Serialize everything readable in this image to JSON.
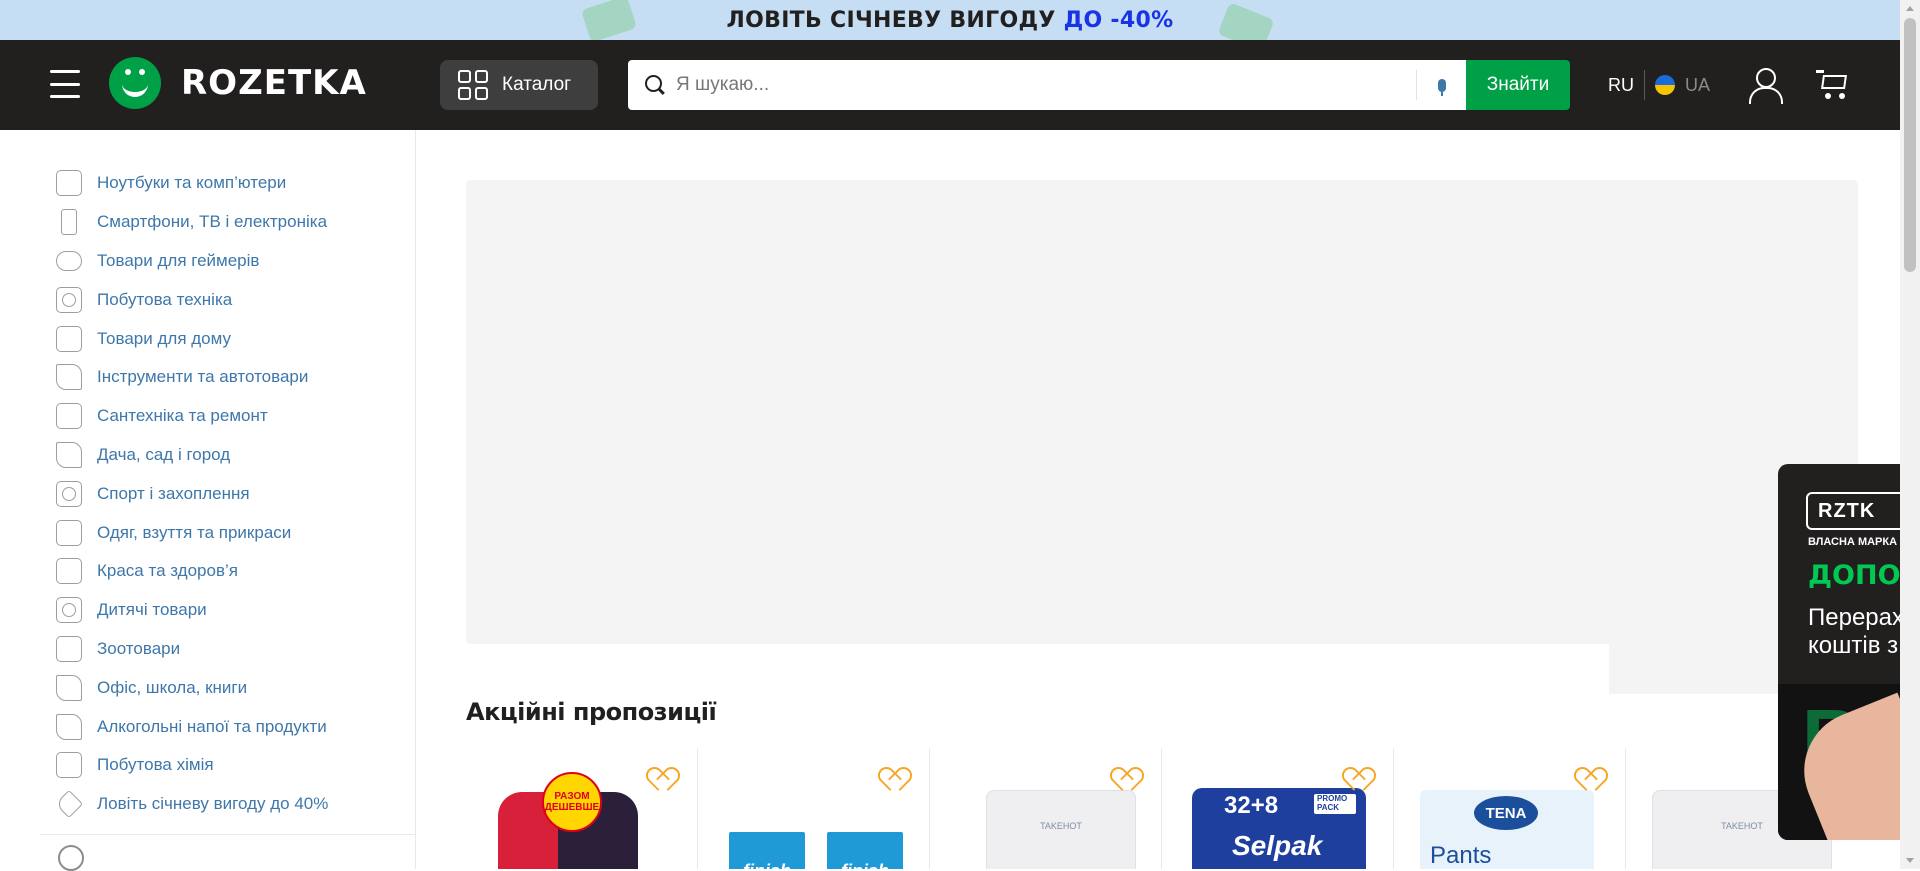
{
  "promo_banner": {
    "text_main": "ЛОВІТЬ СІЧНЕВУ ВИГОДУ ",
    "text_accent": "ДО -40%",
    "bg_color": "#c5def3",
    "accent_color": "#1b33e6"
  },
  "header": {
    "menu_icon": "hamburger-icon",
    "logo_text": "ROZETKA",
    "catalog_label": "Каталог",
    "search": {
      "placeholder": "Я шукаю...",
      "value": "",
      "button_label": "Знайти",
      "mic_icon": "microphone-icon"
    },
    "lang": {
      "ru": "RU",
      "ua": "UA",
      "active": "UA"
    },
    "user_icon": "user-icon",
    "cart_icon": "cart-icon",
    "bg_color": "#221f1f",
    "brand_green": "#00a046"
  },
  "sidebar": {
    "categories": [
      {
        "label": "Ноутбуки та комп’ютери",
        "icon": "laptop-icon"
      },
      {
        "label": "Смартфони, ТВ і електроніка",
        "icon": "smartphone-icon"
      },
      {
        "label": "Товари для геймерів",
        "icon": "gamepad-icon"
      },
      {
        "label": "Побутова техніка",
        "icon": "washing-machine-icon"
      },
      {
        "label": "Товари для дому",
        "icon": "armchair-icon"
      },
      {
        "label": "Інструменти та автотовари",
        "icon": "drill-icon"
      },
      {
        "label": "Сантехніка та ремонт",
        "icon": "bathtub-icon"
      },
      {
        "label": "Дача, сад і город",
        "icon": "garden-tools-icon"
      },
      {
        "label": "Спорт і захоплення",
        "icon": "racket-icon"
      },
      {
        "label": "Одяг, взуття та прикраси",
        "icon": "tshirt-icon"
      },
      {
        "label": "Краса та здоров’я",
        "icon": "cosmetics-icon"
      },
      {
        "label": "Дитячі товари",
        "icon": "teddy-bear-icon"
      },
      {
        "label": "Зоотовари",
        "icon": "paw-icon"
      },
      {
        "label": "Офіс, школа, книги",
        "icon": "paperclip-icon"
      },
      {
        "label": "Алкогольні напої та продукти",
        "icon": "cocktail-icon"
      },
      {
        "label": "Побутова хімія",
        "icon": "spray-bottle-icon"
      },
      {
        "label": "Ловіть січневу вигоду до 40%",
        "icon": "tag-icon"
      }
    ],
    "link_color": "#3e77aa"
  },
  "main": {
    "section_title": "Акційні пропозиції",
    "products": [
      {
        "sticker": "РАЗОМ ДЕШЕВШЕ",
        "fav_icon": "heart-icon"
      },
      {
        "brand": "finish",
        "fav_icon": "heart-icon"
      },
      {
        "brand": "TAKEHOT",
        "fav_icon": "heart-icon"
      },
      {
        "count": "32+8",
        "promo": "PROMO PACK",
        "brand": "Selpak",
        "fav_icon": "heart-icon"
      },
      {
        "brand": "TENA",
        "name": "Pants",
        "fav_icon": "heart-icon"
      },
      {
        "brand": "TAKEHOT",
        "fav_icon": "heart-icon"
      }
    ],
    "favorite_color": "#f5a623"
  },
  "side_ad": {
    "logo": "RZTK",
    "subtitle": "ВЛАСНА МАРКА",
    "headline": "ДОПОМ",
    "body_line1": "Перерах",
    "body_line2": "коштів з",
    "photo_text": "RZ",
    "headline_color": "#00c853"
  }
}
